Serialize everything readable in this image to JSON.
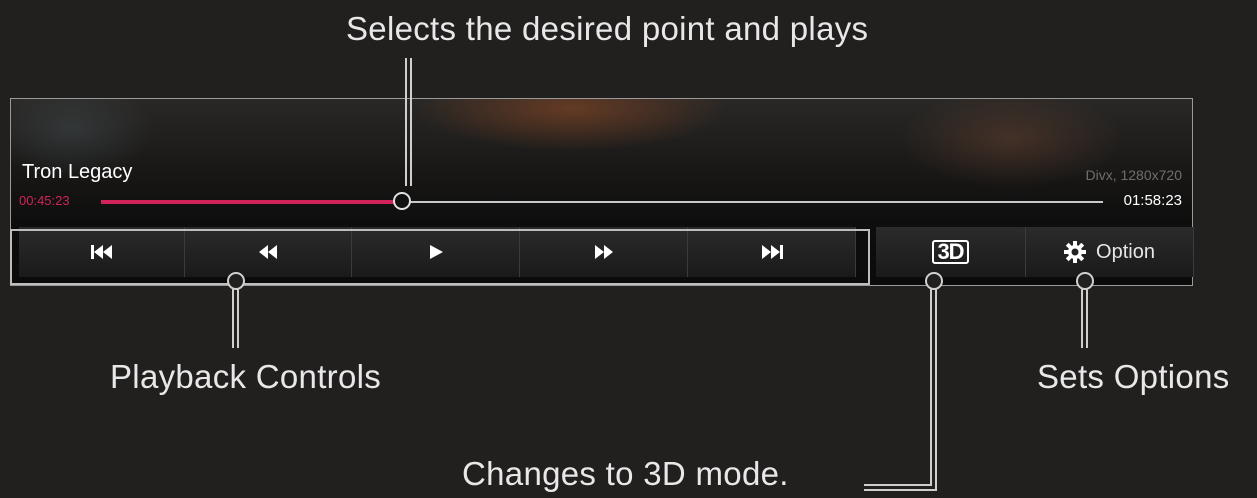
{
  "callouts": {
    "seek": "Selects the desired point and plays",
    "playback": "Playback Controls",
    "options": "Sets Options",
    "mode_3d": "Changes to 3D mode."
  },
  "player": {
    "title": "Tron Legacy",
    "meta": "Divx, 1280x720",
    "current_time": "00:45:23",
    "total_time": "01:58:23",
    "progress_fraction": 0.3,
    "accent_color": "#d1235a",
    "controls": [
      {
        "name": "skip-previous-icon",
        "icon": "skip-previous"
      },
      {
        "name": "rewind-icon",
        "icon": "rewind"
      },
      {
        "name": "play-icon",
        "icon": "play"
      },
      {
        "name": "fast-forward-icon",
        "icon": "fast-forward"
      },
      {
        "name": "skip-next-icon",
        "icon": "skip-next"
      }
    ],
    "mode_3d_label": "3D",
    "option_label": "Option",
    "option_icon": "gear-icon"
  }
}
